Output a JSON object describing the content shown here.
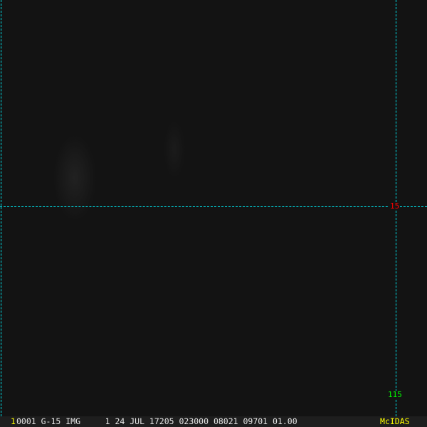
{
  "grid_labels": {
    "lat": "15",
    "lon": "115"
  },
  "status_bar": {
    "frame": "1",
    "fields": "0001 G-15 IMG     1 24 JUL 17205 023000 08021 09701 01.00",
    "brand": "McIDAS"
  },
  "colors": {
    "grid": "#00e5ee",
    "lat_label": "#ff0000",
    "lon_label": "#00ff00",
    "brand": "#ffff00"
  }
}
